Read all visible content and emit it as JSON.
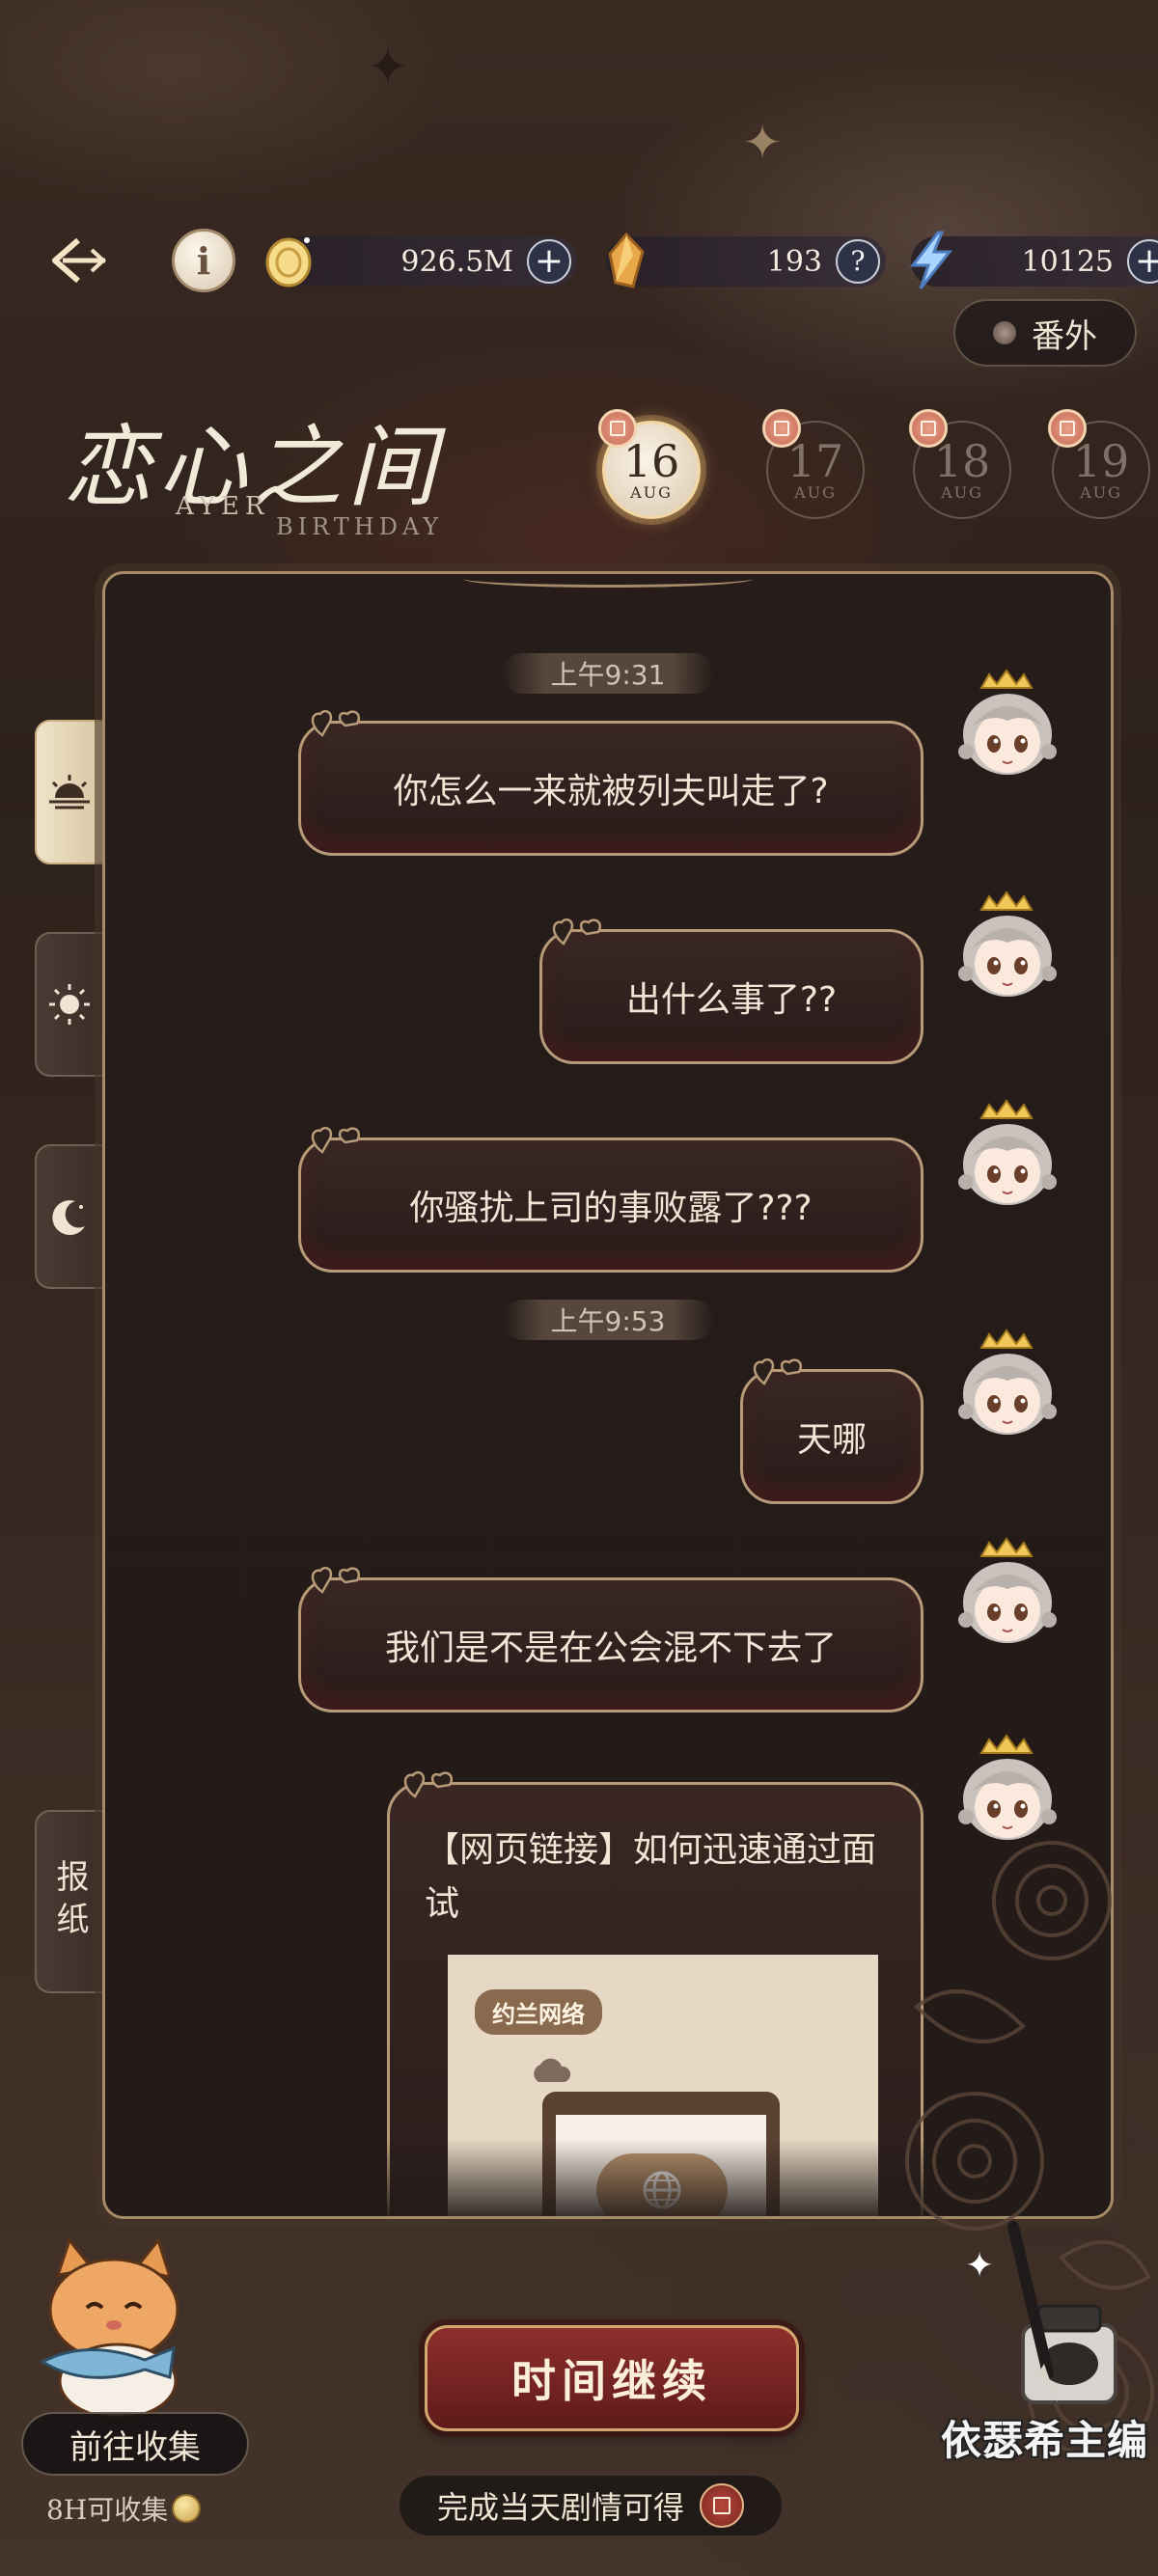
{
  "header": {
    "gold": {
      "value": "926.5M",
      "icon": "gold-coin-icon"
    },
    "gems": {
      "value": "193",
      "icon": "gem-icon"
    },
    "energy": {
      "value": "10125",
      "icon": "lightning-icon"
    },
    "extra_label": "番外"
  },
  "title": {
    "main": "恋心之间",
    "sub1": "AYER",
    "sub2": "BIRTHDAY"
  },
  "dates": [
    {
      "day": "16",
      "month": "AUG",
      "active": true
    },
    {
      "day": "17",
      "month": "AUG",
      "active": false
    },
    {
      "day": "18",
      "month": "AUG",
      "active": false
    },
    {
      "day": "19",
      "month": "AUG",
      "active": false
    }
  ],
  "side_tabs": {
    "newspaper_label": "报纸"
  },
  "chat": {
    "times": [
      "上午9:31",
      "上午9:53"
    ],
    "messages": [
      "你怎么一来就被列夫叫走了?",
      "出什么事了??",
      "你骚扰上司的事败露了???",
      "天哪",
      "我们是不是在公会混不下去了"
    ],
    "link": {
      "title": "【网页链接】如何迅速通过面试",
      "thumb_label": "约兰网络"
    }
  },
  "footer": {
    "collect_label": "前往收集",
    "collect_note": "8H可收集",
    "continue_label": "时间继续",
    "reward_note": "完成当天剧情可得",
    "watermark": "依瑟希主编"
  },
  "colors": {
    "accent_gold": "#b79a78",
    "button_red": "#8e2f2c",
    "background": "#2b2019"
  }
}
